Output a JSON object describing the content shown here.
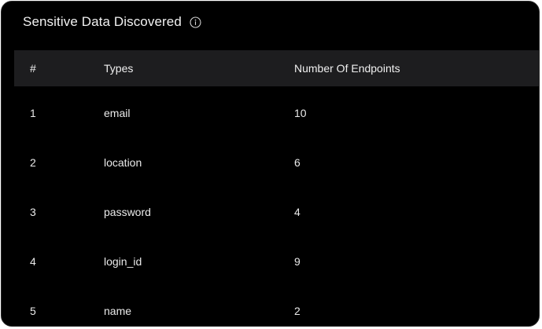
{
  "card": {
    "title": "Sensitive Data Discovered",
    "info_icon": "info-icon"
  },
  "table": {
    "columns": [
      "#",
      "Types",
      "Number Of Endpoints"
    ],
    "rows": [
      {
        "index": "1",
        "type": "email",
        "count": "10"
      },
      {
        "index": "2",
        "type": "location",
        "count": "6"
      },
      {
        "index": "3",
        "type": "password",
        "count": "4"
      },
      {
        "index": "4",
        "type": "login_id",
        "count": "9"
      },
      {
        "index": "5",
        "type": "name",
        "count": "2"
      }
    ]
  },
  "colors": {
    "background": "#000000",
    "header_row": "#1d1d1f",
    "text": "#eaeaea"
  }
}
